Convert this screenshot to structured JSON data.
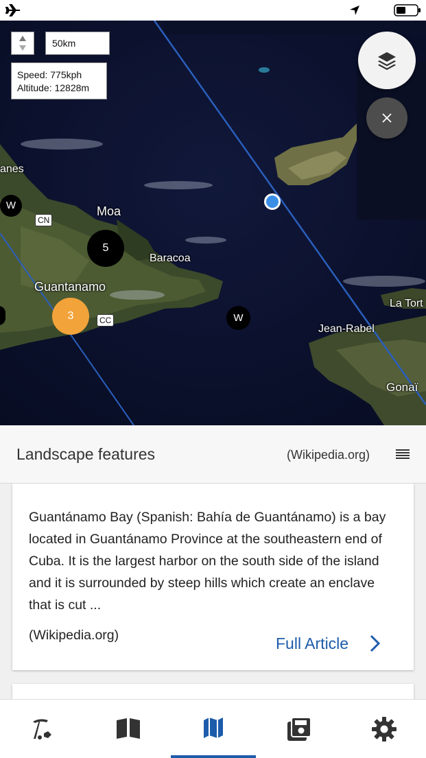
{
  "status_bar": {
    "airplane_icon": "airplane-icon",
    "location_icon": "location-arrow-icon",
    "battery_icon": "battery-icon"
  },
  "map": {
    "scale": "50km",
    "speed": "Speed: 775kph",
    "altitude": "Altitude: 12828m",
    "places": [
      "anes",
      "Moa",
      "Baracoa",
      "Guantanamo",
      "La Tort",
      "Jean-Rabel",
      "Gonaï"
    ],
    "badges": [
      "CN",
      "CC"
    ],
    "clusters": [
      {
        "label": "5",
        "color": "#000000"
      },
      {
        "label": "3",
        "color": "#f2a33a"
      },
      {
        "label": "W",
        "color": "#000000"
      },
      {
        "label": "W",
        "color": "#000000"
      }
    ],
    "layers_icon": "layers-icon",
    "close_icon": "close-icon",
    "route_color": "#2a5fbd",
    "position_color": "#3a8ee6"
  },
  "panel": {
    "title": "Landscape features",
    "source": "(Wikipedia.org)",
    "menu_icon": "menu-icon"
  },
  "card": {
    "text": "Guantánamo Bay (Spanish: Bahía de Guantánamo) is a bay located in Guantánamo Province at the southeastern end of Cuba. It is the largest harbor on the south side of the island and it is surrounded by steep hills which create an enclave that is cut ...",
    "source": "(Wikipedia.org)",
    "link": "Full Article"
  },
  "tabs": [
    {
      "icon": "pickaxe-icon",
      "active": false
    },
    {
      "icon": "book-icon",
      "active": false
    },
    {
      "icon": "map-icon",
      "active": true
    },
    {
      "icon": "save-icon",
      "active": false
    },
    {
      "icon": "gear-icon",
      "active": false
    }
  ],
  "accent_color": "#1d5bab"
}
